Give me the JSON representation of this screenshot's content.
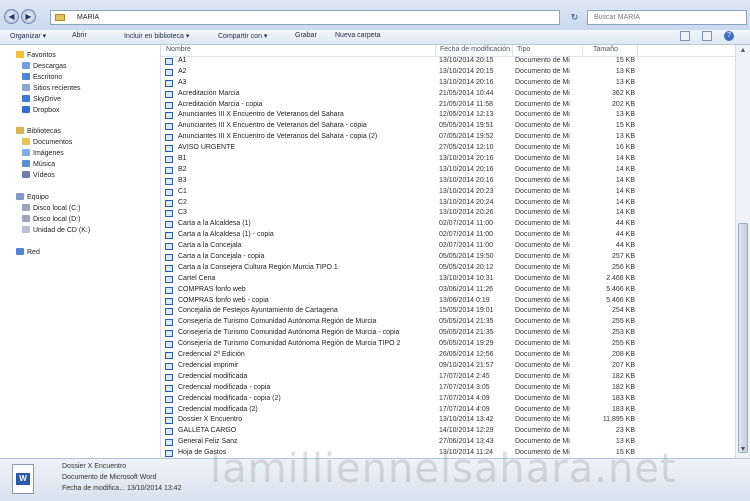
{
  "address": {
    "path": "MARIA",
    "search_placeholder": "Buscar MARIA"
  },
  "toolbar": {
    "organize": "Organizar ▾",
    "open": "Abrir",
    "include_library": "Incluir en biblioteca ▾",
    "share": "Compartir con ▾",
    "burn": "Grabar",
    "new_folder": "Nueva carpeta"
  },
  "nav": {
    "favorites": "Favoritos",
    "favorites_items": [
      "Descargas",
      "Escritorio",
      "Sitios recientes",
      "SkyDrive",
      "Dropbox"
    ],
    "libraries": "Bibliotecas",
    "libraries_items": [
      "Documentos",
      "Imágenes",
      "Música",
      "Vídeos"
    ],
    "computer": "Equipo",
    "computer_items": [
      "Disco local (C:)",
      "Disco local (D:)",
      "Unidad de CD (K:)"
    ],
    "network": "Red"
  },
  "columns": {
    "name": "Nombre",
    "date": "Fecha de modificación",
    "type": "Tipo",
    "size": "Tamaño"
  },
  "files": [
    {
      "name": "A1",
      "date": "13/10/2014 20:15",
      "type": "Documento de Mi",
      "size": "15 KB"
    },
    {
      "name": "A2",
      "date": "13/10/2014 20:15",
      "type": "Documento de Mi",
      "size": "13 KB"
    },
    {
      "name": "A3",
      "date": "13/10/2014 20:16",
      "type": "Documento de Mi",
      "size": "13 KB"
    },
    {
      "name": "Acreditación Marcia",
      "date": "21/05/2014 10:44",
      "type": "Documento de Mi",
      "size": "362 KB"
    },
    {
      "name": "Acreditación Marcia - copia",
      "date": "21/05/2014 11:58",
      "type": "Documento de Mi",
      "size": "202 KB"
    },
    {
      "name": "Anunciantes III X Encuentro de Veteranos del Sahara",
      "date": "12/05/2014 12:13",
      "type": "Documento de Mi",
      "size": "13 KB"
    },
    {
      "name": "Anunciantes III X Encuentro de Veteranos del Sahara - copia",
      "date": "05/05/2014 19:51",
      "type": "Documento de Mi",
      "size": "15 KB"
    },
    {
      "name": "Anunciantes III X Encuentro de Veteranos del Sahara - copia (2)",
      "date": "07/05/2014 19:52",
      "type": "Documento de Mi",
      "size": "13 KB"
    },
    {
      "name": "AVISO URGENTE",
      "date": "27/05/2014 12:10",
      "type": "Documento de Mi",
      "size": "16 KB"
    },
    {
      "name": "B1",
      "date": "13/10/2014 20:16",
      "type": "Documento de Mi",
      "size": "14 KB"
    },
    {
      "name": "B2",
      "date": "13/10/2014 20:16",
      "type": "Documento de Mi",
      "size": "14 KB"
    },
    {
      "name": "B3",
      "date": "13/10/2014 20:16",
      "type": "Documento de Mi",
      "size": "14 KB"
    },
    {
      "name": "C1",
      "date": "13/10/2014 20:23",
      "type": "Documento de Mi",
      "size": "14 KB"
    },
    {
      "name": "C2",
      "date": "13/10/2014 20:24",
      "type": "Documento de Mi",
      "size": "14 KB"
    },
    {
      "name": "C3",
      "date": "13/10/2014 20:26",
      "type": "Documento de Mi",
      "size": "14 KB"
    },
    {
      "name": "Carta a la Alcaldesa (1)",
      "date": "02/07/2014 11:00",
      "type": "Documento de Mi",
      "size": "44 KB"
    },
    {
      "name": "Carta a la Alcaldesa (1) - copia",
      "date": "02/07/2014 11:00",
      "type": "Documento de Mi",
      "size": "44 KB"
    },
    {
      "name": "Carta a la Concejala",
      "date": "02/07/2014 11:00",
      "type": "Documento de Mi",
      "size": "44 KB"
    },
    {
      "name": "Carta a la Concejala - copia",
      "date": "05/05/2014 19:50",
      "type": "Documento de Mi",
      "size": "257 KB"
    },
    {
      "name": "Carta a la Consejera Cultura Región Murcia TIPO 1",
      "date": "05/05/2014 20:12",
      "type": "Documento de Mi",
      "size": "256 KB"
    },
    {
      "name": "Cartel Cena",
      "date": "13/10/2014 10:31",
      "type": "Documento de Mi",
      "size": "2.466 KB"
    },
    {
      "name": "COMPRAS fonfo web",
      "date": "03/06/2014 11:26",
      "type": "Documento de Mi",
      "size": "5.466 KB"
    },
    {
      "name": "COMPRAS fonfo web - copia",
      "date": "13/06/2014 0:19",
      "type": "Documento de Mi",
      "size": "5.466 KB"
    },
    {
      "name": "Concejalía de Festejos Ayuntamiento de Cartagena",
      "date": "15/05/2014 19:01",
      "type": "Documento de Mi",
      "size": "254 KB"
    },
    {
      "name": "Consejería de Turismo Comunidad Autónoma Región de Murcia",
      "date": "05/05/2014 21:35",
      "type": "Documento de Mi",
      "size": "255 KB"
    },
    {
      "name": "Consejería de Turismo Comunidad Autónoma Región de Murcia - copia",
      "date": "05/05/2014 21:35",
      "type": "Documento de Mi",
      "size": "253 KB"
    },
    {
      "name": "Consejería de Turismo Comunidad Autónoma Región de Murcia TIPO 2",
      "date": "05/05/2014 19:29",
      "type": "Documento de Mi",
      "size": "255 KB"
    },
    {
      "name": "Credencial 2ª Edición",
      "date": "26/05/2014 12:56",
      "type": "Documento de Mi",
      "size": "208 KB"
    },
    {
      "name": "Credencial imprimir",
      "date": "09/10/2014 21:57",
      "type": "Documento de Mi",
      "size": "207 KB"
    },
    {
      "name": "Credencial modificada",
      "date": "17/07/2014 2:45",
      "type": "Documento de Mi",
      "size": "182 KB"
    },
    {
      "name": "Credencial modificada - copia",
      "date": "17/07/2014 3:05",
      "type": "Documento de Mi",
      "size": "182 KB"
    },
    {
      "name": "Credencial modificada - copia (2)",
      "date": "17/07/2014 4:09",
      "type": "Documento de Mi",
      "size": "183 KB"
    },
    {
      "name": "Credencial modificada (2)",
      "date": "17/07/2014 4:09",
      "type": "Documento de Mi",
      "size": "183 KB"
    },
    {
      "name": "Dossier X Encuentro",
      "date": "13/10/2014 13:42",
      "type": "Documento de Mi",
      "size": "11.895 KB"
    },
    {
      "name": "GALLETA CARGO",
      "date": "14/10/2014 12:29",
      "type": "Documento de Mi",
      "size": "23 KB"
    },
    {
      "name": "General Feliz Sanz",
      "date": "27/06/2014 13:43",
      "type": "Documento de Mi",
      "size": "13 KB"
    },
    {
      "name": "Hoja de Gastos",
      "date": "13/10/2014 11:24",
      "type": "Documento de Mi",
      "size": "15 KB"
    }
  ],
  "details": {
    "line1": "Dossier X Encuentro",
    "line2": "Documento de Microsoft Word",
    "line3": "Fecha de modifica... 13/10/2014 13:42"
  },
  "watermark": "lamilliennelsahara.net"
}
